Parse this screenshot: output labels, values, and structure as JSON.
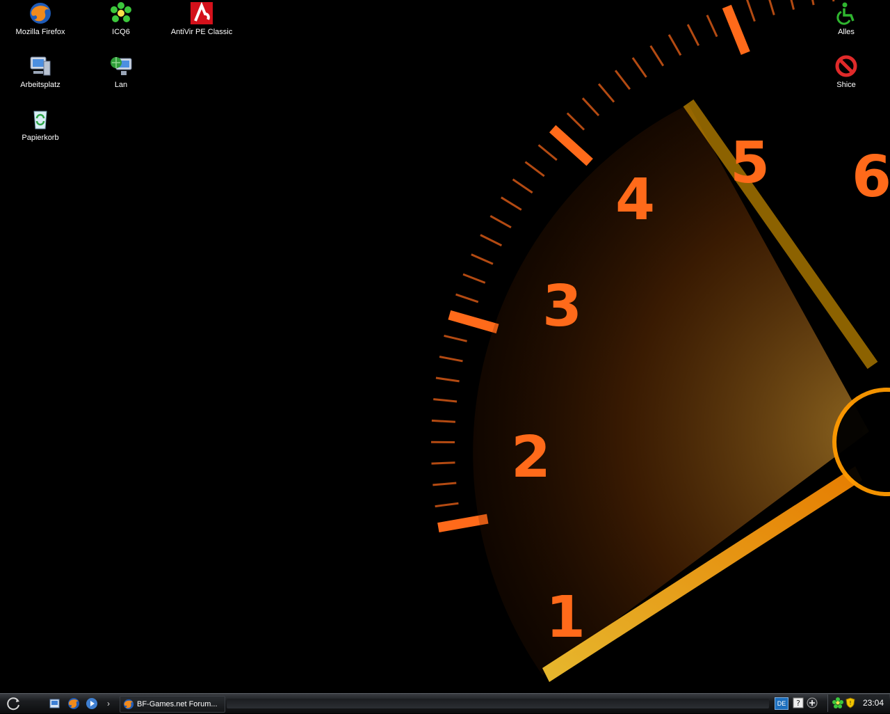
{
  "desktop": {
    "icons": [
      {
        "label": "Mozilla Firefox",
        "icon": "firefox-icon"
      },
      {
        "label": "ICQ6",
        "icon": "icq-flower-icon"
      },
      {
        "label": "AntiVir PE Classic",
        "icon": "antivir-umbrella-icon"
      },
      {
        "label": "Arbeitsplatz",
        "icon": "my-computer-icon"
      },
      {
        "label": "Lan",
        "icon": "network-globe-icon"
      },
      {
        "label": "Papierkorb",
        "icon": "recycle-bin-icon"
      },
      {
        "label": "Alles",
        "icon": "wheelchair-icon"
      },
      {
        "label": "Shice",
        "icon": "no-entry-icon"
      }
    ]
  },
  "wallpaper": {
    "gauge_numbers": [
      "1",
      "2",
      "3",
      "4",
      "5",
      "6"
    ],
    "accent_color": "#ff6a1a",
    "glow_color": "#ffb020"
  },
  "taskbar": {
    "start_icon": "start-orb-icon",
    "quicklaunch": [
      "show-desktop-icon",
      "firefox-icon",
      "media-player-icon"
    ],
    "more_label": "›",
    "active_task": {
      "label": "BF-Games.net Forum...",
      "icon": "firefox-icon"
    },
    "language": "DE",
    "tray_icons": [
      "help-icon",
      "add-icon",
      "network-status-icon",
      "security-shield-icon"
    ],
    "clock": "23:04"
  }
}
